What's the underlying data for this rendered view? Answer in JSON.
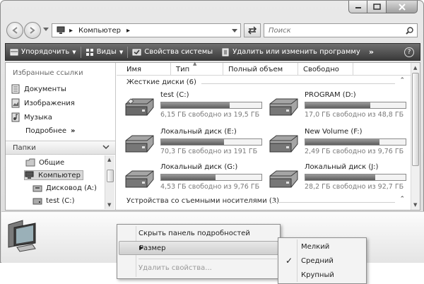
{
  "address": {
    "crumb": "Компьютер",
    "crumb_sep": "▸"
  },
  "search": {
    "placeholder": "Поиск"
  },
  "toolbar": {
    "organize": "Упорядочить",
    "views": "Виды",
    "system_props": "Свойства системы",
    "uninstall": "Удалить или изменить программу",
    "more": "»",
    "help": "?"
  },
  "nav": {
    "favorites_title": "Избранные ссылки",
    "favorites": [
      "Документы",
      "Изображения",
      "Музыка"
    ],
    "more": "Подробнее",
    "folders_title": "Папки",
    "tree": [
      "Общие",
      "Компьютер",
      "Дисковод (A:)",
      "test (C:)"
    ]
  },
  "columns": [
    "Имя",
    "Тип",
    "Полный объем",
    "Свободно"
  ],
  "groups": {
    "hdd": "Жесткие диски (6)",
    "removable": "Устройства со съемными носителями (3)"
  },
  "drives": [
    {
      "name": "test (C:)",
      "info": "6,15 ГБ свободно из 19,5 ГБ",
      "used": 0.68
    },
    {
      "name": "PROGRAM (D:)",
      "info": "17,0 ГБ свободно из 48,8 ГБ",
      "used": 0.65
    },
    {
      "name": "Локальный диск (E:)",
      "info": "70,3 ГБ свободно из 191 ГБ",
      "used": 0.63
    },
    {
      "name": "New Volume (F:)",
      "info": "2,49 ГБ свободно из 9,76 ГБ",
      "used": 0.74
    },
    {
      "name": "Локальный диск (G:)",
      "info": "4,53 ГБ свободно из 9,76 ГБ",
      "used": 0.54
    },
    {
      "name": "Локальный диск (J:)",
      "info": "28,2 ГБ свободно из 92,7 ГБ",
      "used": 0.7
    }
  ],
  "menu": {
    "hide_details": "Скрыть панель подробностей",
    "size": "Размер",
    "remove_props": "Удалить свойства..."
  },
  "submenu": {
    "small": "Мелкий",
    "medium": "Средний",
    "large": "Крупный",
    "check": "✓"
  }
}
